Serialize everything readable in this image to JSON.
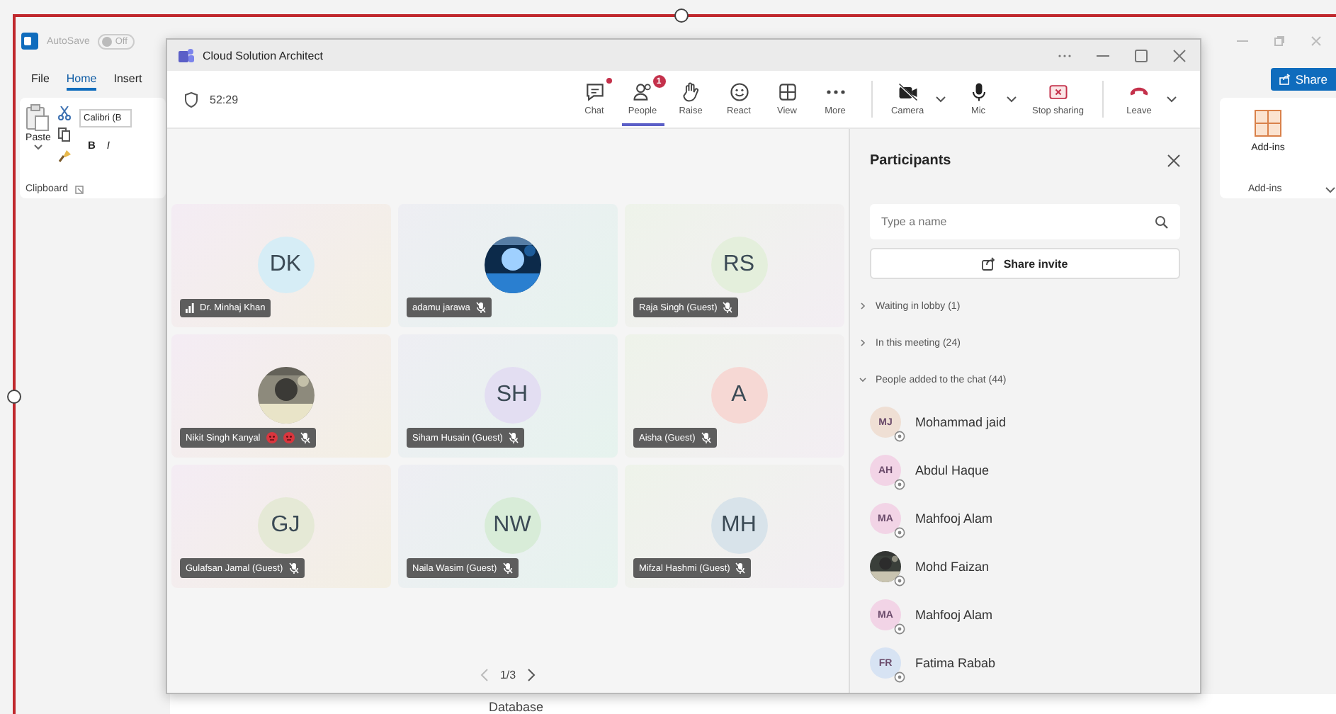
{
  "background_app": {
    "autosave_label": "AutoSave",
    "autosave_toggle": {
      "label": "Off",
      "on": false
    },
    "menu_tabs": [
      {
        "label": "File",
        "selected": false
      },
      {
        "label": "Home",
        "selected": true
      },
      {
        "label": "Insert",
        "selected": false
      }
    ],
    "paste_button": "Paste",
    "font_field": "Calibri (B",
    "format_buttons": [
      "B",
      "I"
    ],
    "clipboard_group": "Clipboard",
    "share_button": "Share",
    "addins_button": "Add-ins",
    "addins_group": "Add-ins",
    "document_text": "Database"
  },
  "window": {
    "title": "Cloud Solution Architect"
  },
  "meeting": {
    "timer": "52:29"
  },
  "toolbar": [
    {
      "label": "Chat",
      "selected": false,
      "notify": true
    },
    {
      "label": "People",
      "selected": true,
      "badge": "1"
    },
    {
      "label": "Raise",
      "selected": false
    },
    {
      "label": "React",
      "selected": false
    },
    {
      "label": "View",
      "selected": false
    },
    {
      "label": "More",
      "selected": false
    },
    {
      "label": "Camera",
      "selected": false,
      "separator_before": true,
      "dropdown": true
    },
    {
      "label": "Mic",
      "selected": false,
      "dropdown": true
    },
    {
      "label": "Stop sharing",
      "selected": false
    },
    {
      "label": "Leave",
      "selected": false,
      "separator_before": true,
      "dropdown": true
    }
  ],
  "tiles": [
    {
      "name": "Dr. Minhaj Khan",
      "kind": "initials",
      "initials": "DK",
      "color": "#d6edf6",
      "muted": false
    },
    {
      "name": "adamu jarawa",
      "kind": "picture",
      "muted": true
    },
    {
      "name": "Raja Singh (Guest)",
      "kind": "initials",
      "initials": "RS",
      "color": "#e4efdc",
      "muted": true
    },
    {
      "name": "Nikit Singh Kanyal",
      "kind": "picture",
      "muted": true,
      "emoji_reactions": true
    },
    {
      "name": "Siham Husain (Guest)",
      "kind": "initials",
      "initials": "SH",
      "color": "#e3def2",
      "muted": true
    },
    {
      "name": "Aisha (Guest)",
      "kind": "initials",
      "initials": "A",
      "color": "#f6d8d4",
      "muted": true
    },
    {
      "name": "Gulafsan Jamal (Guest)",
      "kind": "initials",
      "initials": "GJ",
      "color": "#e5e9d6",
      "muted": true
    },
    {
      "name": "Naila Wasim (Guest)",
      "kind": "initials",
      "initials": "NW",
      "color": "#d8ecd8",
      "muted": true
    },
    {
      "name": "Mifzal Hashmi (Guest)",
      "kind": "initials",
      "initials": "MH",
      "color": "#d8e3ea",
      "muted": true
    }
  ],
  "pager": {
    "label": "1/3"
  },
  "participants": {
    "title": "Participants",
    "search_placeholder": "Type a name",
    "share_button": "Share invite",
    "sections": [
      {
        "label": "Waiting in lobby (1)",
        "expanded": false
      },
      {
        "label": "In this meeting (24)",
        "expanded": false
      },
      {
        "label": "People added to the chat (44)",
        "expanded": true,
        "people": [
          {
            "name": "Mohammad jaid",
            "kind": "initials",
            "initials": "MJ",
            "color": "#efdfd4"
          },
          {
            "name": "Abdul Haque",
            "kind": "initials",
            "initials": "AH",
            "color": "#f2d4e6"
          },
          {
            "name": "Mahfooj Alam",
            "kind": "initials",
            "initials": "MA",
            "color": "#f2d4e6"
          },
          {
            "name": "Mohd Faizan",
            "kind": "picture"
          },
          {
            "name": "Mahfooj Alam",
            "kind": "initials",
            "initials": "MA",
            "color": "#f2d4e6"
          },
          {
            "name": "Fatima Rabab",
            "kind": "initials",
            "initials": "FR",
            "color": "#d7e3f3"
          }
        ]
      }
    ]
  }
}
